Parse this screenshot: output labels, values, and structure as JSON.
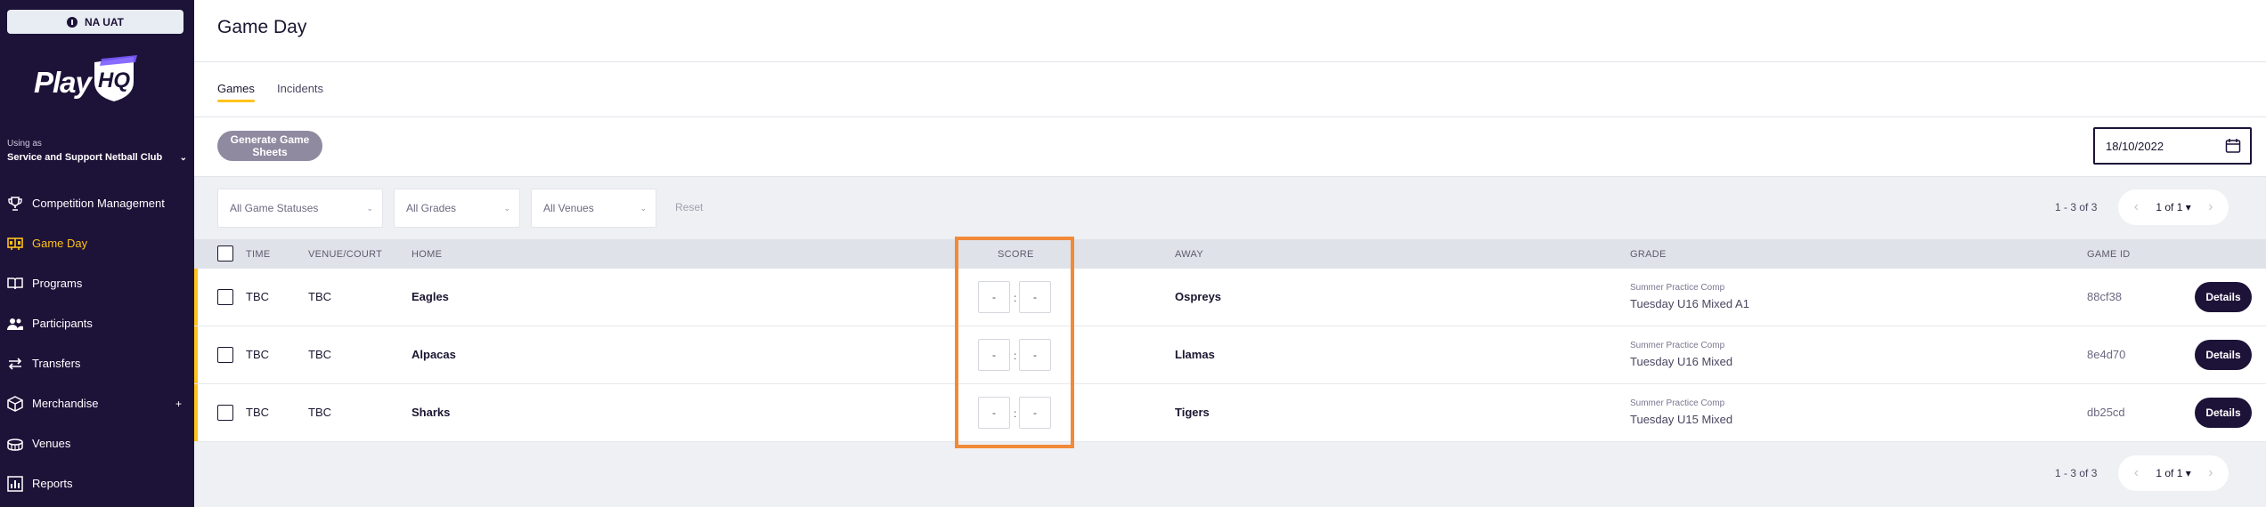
{
  "env": {
    "label": "NA UAT"
  },
  "logo": {
    "text": "Play",
    "mark": "HQ"
  },
  "sidebar": {
    "using_as_label": "Using as",
    "club": "Service and Support Netball Club",
    "items": [
      {
        "label": "Competition Management",
        "icon": "trophy-icon"
      },
      {
        "label": "Game Day",
        "icon": "scoreboard-icon"
      },
      {
        "label": "Programs",
        "icon": "book-icon"
      },
      {
        "label": "Participants",
        "icon": "people-icon"
      },
      {
        "label": "Transfers",
        "icon": "transfer-icon"
      },
      {
        "label": "Merchandise",
        "icon": "box-icon"
      },
      {
        "label": "Venues",
        "icon": "stadium-icon"
      },
      {
        "label": "Reports",
        "icon": "chart-icon"
      }
    ]
  },
  "page": {
    "title": "Game Day"
  },
  "tabs": [
    {
      "label": "Games"
    },
    {
      "label": "Incidents"
    }
  ],
  "actions": {
    "generate": "Generate Game Sheets",
    "date": "18/10/2022"
  },
  "filters": {
    "status": "All Game Statuses",
    "grades": "All Grades",
    "venues": "All Venues",
    "reset": "Reset"
  },
  "pagination": {
    "range": "1 - 3 of 3",
    "page": "1 of 1"
  },
  "table": {
    "headers": {
      "time": "TIME",
      "venue": "VENUE/COURT",
      "home": "HOME",
      "score": "SCORE",
      "away": "AWAY",
      "grade": "GRADE",
      "game_id": "GAME ID"
    },
    "rows": [
      {
        "time": "TBC",
        "venue": "TBC",
        "home": "Eagles",
        "home_score": "-",
        "away_score": "-",
        "away": "Ospreys",
        "comp": "Summer Practice Comp",
        "grade": "Tuesday U16 Mixed A1",
        "game_id": "88cf38",
        "action": "Details"
      },
      {
        "time": "TBC",
        "venue": "TBC",
        "home": "Alpacas",
        "home_score": "-",
        "away_score": "-",
        "away": "Llamas",
        "comp": "Summer Practice Comp",
        "grade": "Tuesday U16 Mixed",
        "game_id": "8e4d70",
        "action": "Details"
      },
      {
        "time": "TBC",
        "venue": "TBC",
        "home": "Sharks",
        "home_score": "-",
        "away_score": "-",
        "away": "Tigers",
        "comp": "Summer Practice Comp",
        "grade": "Tuesday U15 Mixed",
        "game_id": "db25cd",
        "action": "Details"
      }
    ],
    "score_separator": ":"
  },
  "colors": {
    "brand": "#1d1238",
    "accent": "#ffc21a",
    "highlight": "#f28a38"
  }
}
